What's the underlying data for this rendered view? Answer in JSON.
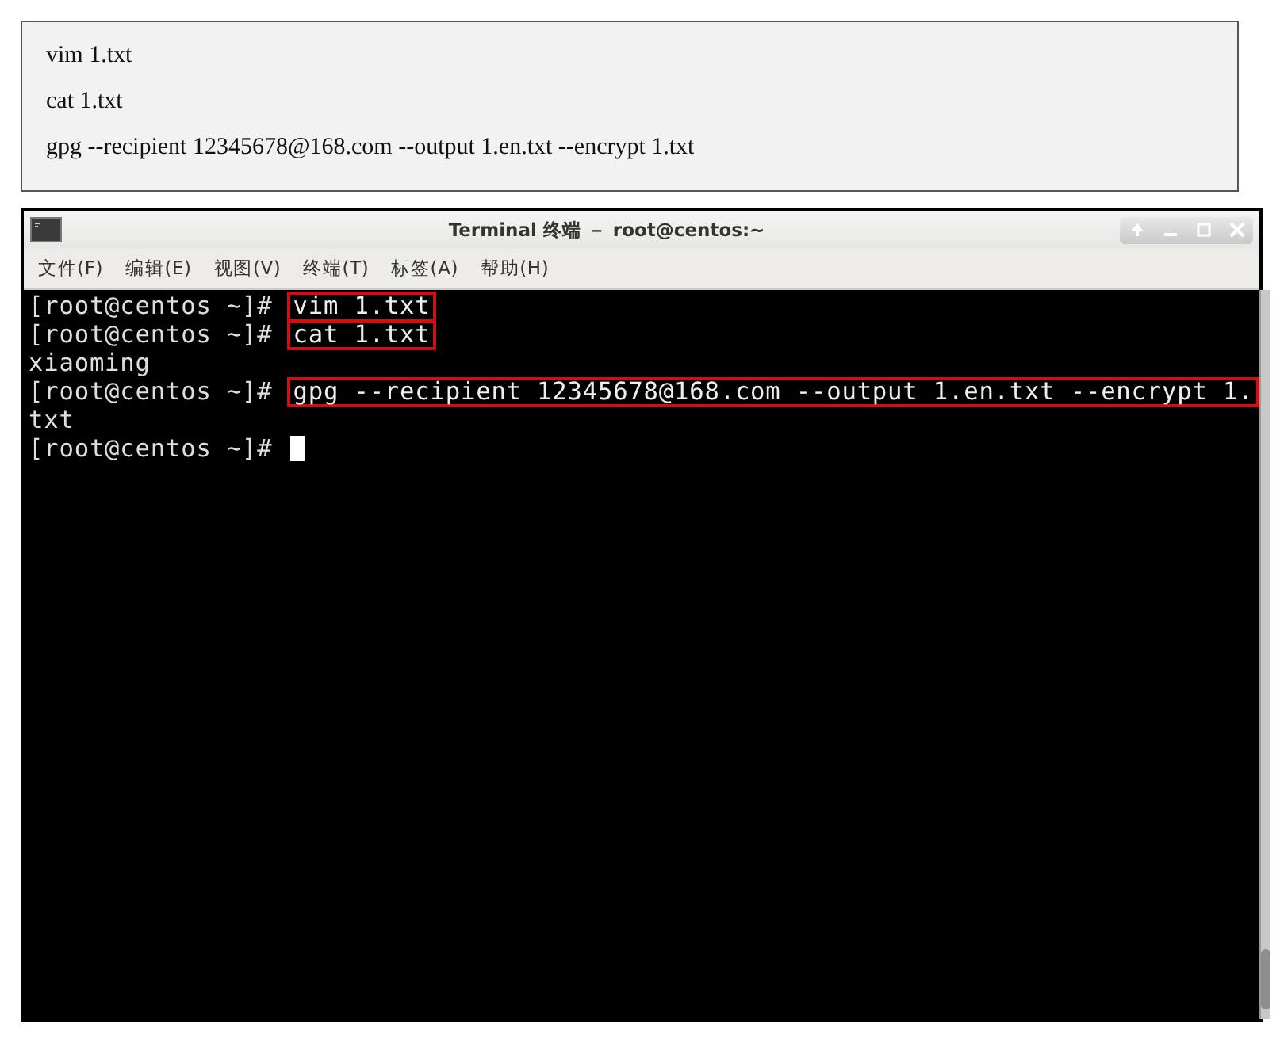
{
  "commands_box": {
    "lines": [
      "vim 1.txt",
      "cat 1.txt",
      "gpg --recipient 12345678@168.com --output 1.en.txt --encrypt 1.txt"
    ]
  },
  "window": {
    "title": "Terminal 终端 － root@centos:~"
  },
  "menu": [
    "文件(F)",
    "编辑(E)",
    "视图(V)",
    "终端(T)",
    "标签(A)",
    "帮助(H)"
  ],
  "terminal": {
    "lines": [
      {
        "kind": "prompt",
        "prompt": "[root@centos ~]#",
        "command": "vim 1.txt",
        "highlighted": true
      },
      {
        "kind": "prompt",
        "prompt": "[root@centos ~]#",
        "command": "cat 1.txt",
        "highlighted": true
      },
      {
        "kind": "output",
        "text": "xiaoming"
      },
      {
        "kind": "prompt",
        "prompt": "[root@centos ~]#",
        "command": "gpg --recipient 12345678@168.com --output 1.en.txt --encrypt 1.",
        "highlighted": true
      },
      {
        "kind": "output",
        "text": "txt"
      },
      {
        "kind": "cursor",
        "prompt": "[root@centos ~]#"
      }
    ]
  }
}
